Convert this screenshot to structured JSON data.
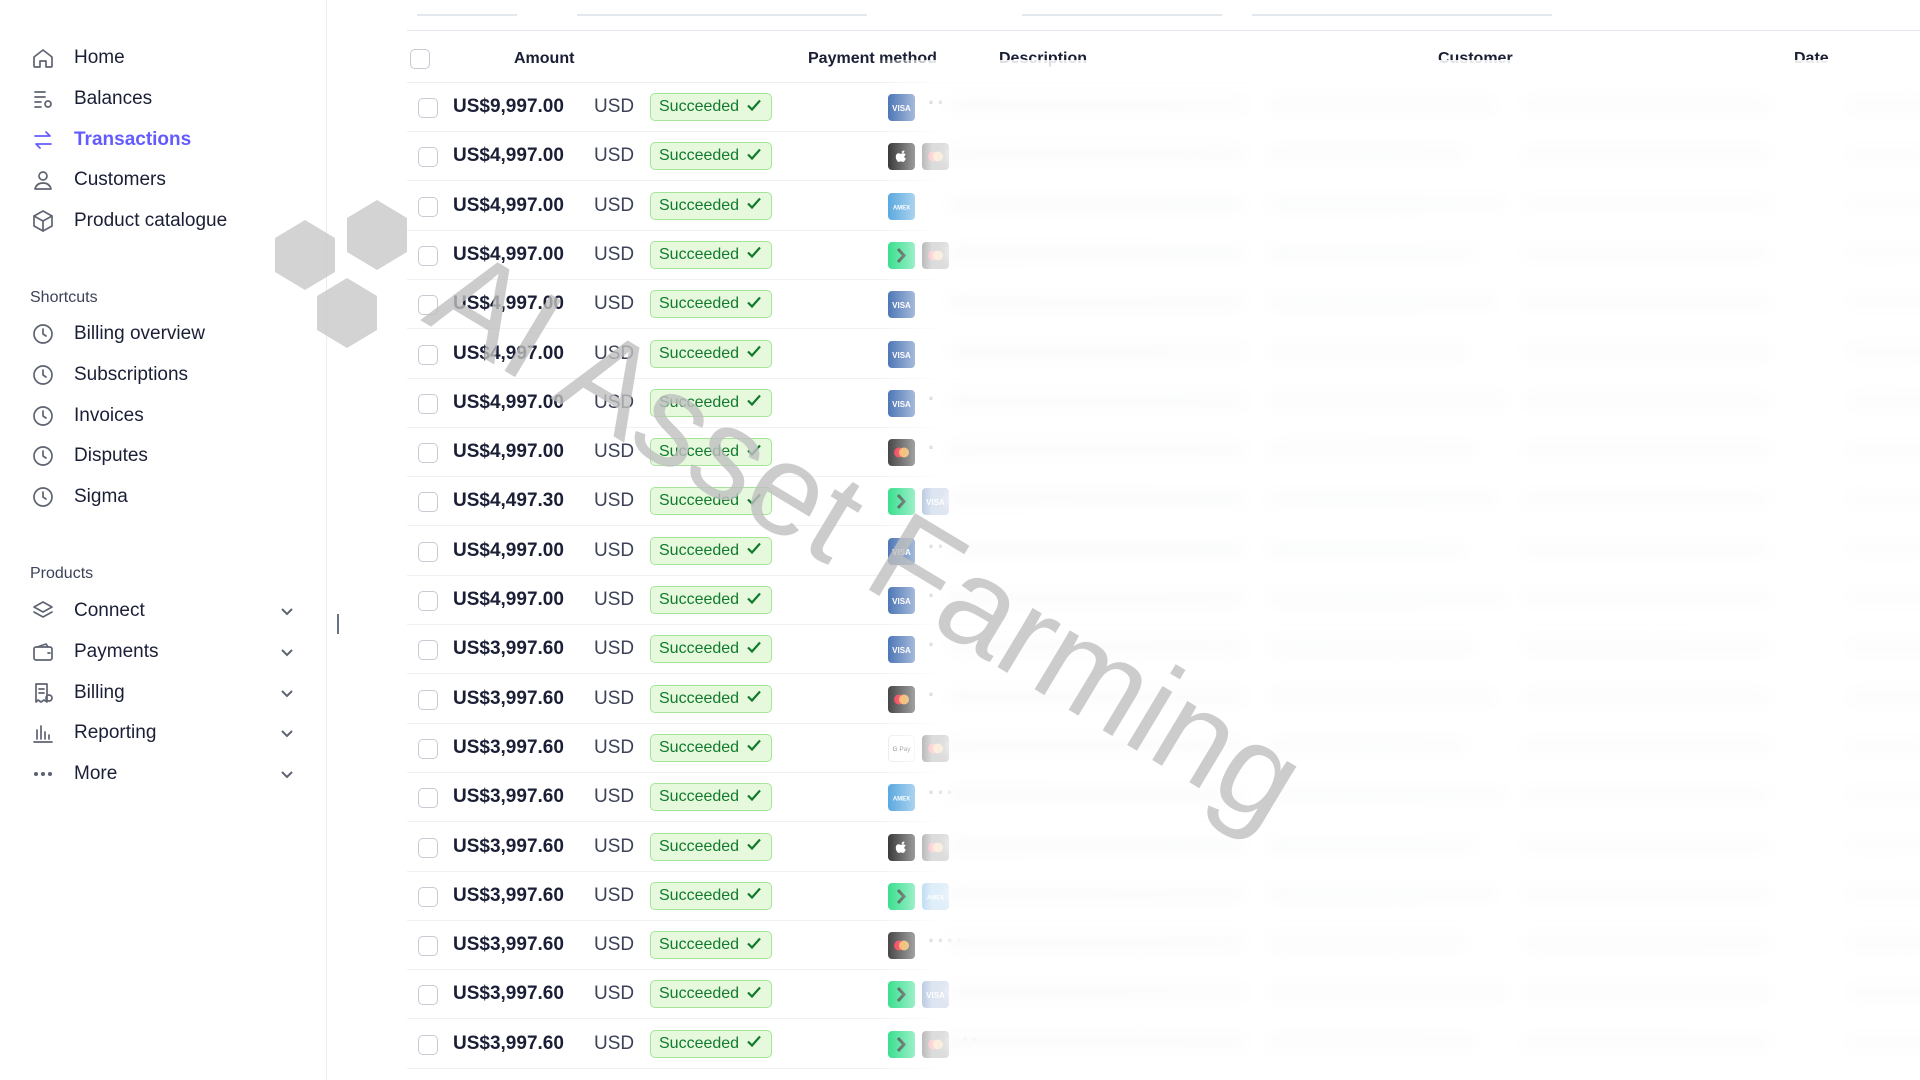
{
  "sidebar": {
    "nav": [
      {
        "label": "Home",
        "icon": "home-icon",
        "active": false
      },
      {
        "label": "Balances",
        "icon": "balances-icon",
        "active": false
      },
      {
        "label": "Transactions",
        "icon": "transactions-icon",
        "active": true
      },
      {
        "label": "Customers",
        "icon": "customers-icon",
        "active": false
      },
      {
        "label": "Product catalogue",
        "icon": "product-catalogue-icon",
        "active": false
      }
    ],
    "shortcuts_title": "Shortcuts",
    "shortcuts": [
      {
        "label": "Billing overview",
        "icon": "clock-icon"
      },
      {
        "label": "Subscriptions",
        "icon": "clock-icon"
      },
      {
        "label": "Invoices",
        "icon": "clock-icon"
      },
      {
        "label": "Disputes",
        "icon": "clock-icon"
      },
      {
        "label": "Sigma",
        "icon": "clock-icon"
      }
    ],
    "products_title": "Products",
    "products": [
      {
        "label": "Connect",
        "icon": "connect-icon"
      },
      {
        "label": "Payments",
        "icon": "payments-icon"
      },
      {
        "label": "Billing",
        "icon": "billing-icon"
      },
      {
        "label": "Reporting",
        "icon": "reporting-icon"
      },
      {
        "label": "More",
        "icon": "more-icon"
      }
    ]
  },
  "table": {
    "columns": {
      "amount": "Amount",
      "payment_method": "Payment method",
      "description": "Description",
      "customer": "Customer",
      "date": "Date"
    },
    "status_label": "Succeeded",
    "currency": "USD",
    "rows": [
      {
        "amount": "US$9,997.00",
        "methods": [
          "visa-icon"
        ],
        "dots": "··"
      },
      {
        "amount": "US$4,997.00",
        "methods": [
          "apple-pay-icon",
          "mastercard-icon"
        ],
        "dots": ""
      },
      {
        "amount": "US$4,997.00",
        "methods": [
          "amex-icon"
        ],
        "dots": ""
      },
      {
        "amount": "US$4,997.00",
        "methods": [
          "link-icon",
          "mastercard-icon"
        ],
        "dots": ""
      },
      {
        "amount": "US$4,997.00",
        "methods": [
          "visa-icon"
        ],
        "dots": ""
      },
      {
        "amount": "US$4,997.00",
        "methods": [
          "visa-icon"
        ],
        "dots": ""
      },
      {
        "amount": "US$4,997.00",
        "methods": [
          "visa-icon"
        ],
        "dots": "·"
      },
      {
        "amount": "US$4,997.00",
        "methods": [
          "mastercard-icon"
        ],
        "dots": "·"
      },
      {
        "amount": "US$4,497.30",
        "methods": [
          "link-icon",
          "visa-icon"
        ],
        "dots": ""
      },
      {
        "amount": "US$4,997.00",
        "methods": [
          "visa-icon"
        ],
        "dots": "··"
      },
      {
        "amount": "US$4,997.00",
        "methods": [
          "visa-icon"
        ],
        "dots": "·"
      },
      {
        "amount": "US$3,997.60",
        "methods": [
          "visa-icon"
        ],
        "dots": "·"
      },
      {
        "amount": "US$3,997.60",
        "methods": [
          "mastercard-icon"
        ],
        "dots": "·"
      },
      {
        "amount": "US$3,997.60",
        "methods": [
          "google-pay-icon",
          "mastercard-icon"
        ],
        "dots": ""
      },
      {
        "amount": "US$3,997.60",
        "methods": [
          "amex-icon"
        ],
        "dots": "···"
      },
      {
        "amount": "US$3,997.60",
        "methods": [
          "apple-pay-icon",
          "mastercard-icon"
        ],
        "dots": ""
      },
      {
        "amount": "US$3,997.60",
        "methods": [
          "link-icon",
          "amex-icon"
        ],
        "dots": ""
      },
      {
        "amount": "US$3,997.60",
        "methods": [
          "mastercard-icon"
        ],
        "dots": "····"
      },
      {
        "amount": "US$3,997.60",
        "methods": [
          "link-icon",
          "visa-icon"
        ],
        "dots": ""
      },
      {
        "amount": "US$3,997.60",
        "methods": [
          "link-icon",
          "mastercard-icon"
        ],
        "dots": "··"
      }
    ]
  },
  "watermark": "AI Asset Farming",
  "colors": {
    "accent": "#635bff",
    "success_bg": "#e6f9dd",
    "success_text": "#117a2d",
    "visa": "#1a4fa0",
    "amex": "#2a8fd6",
    "link": "#00d66f"
  }
}
